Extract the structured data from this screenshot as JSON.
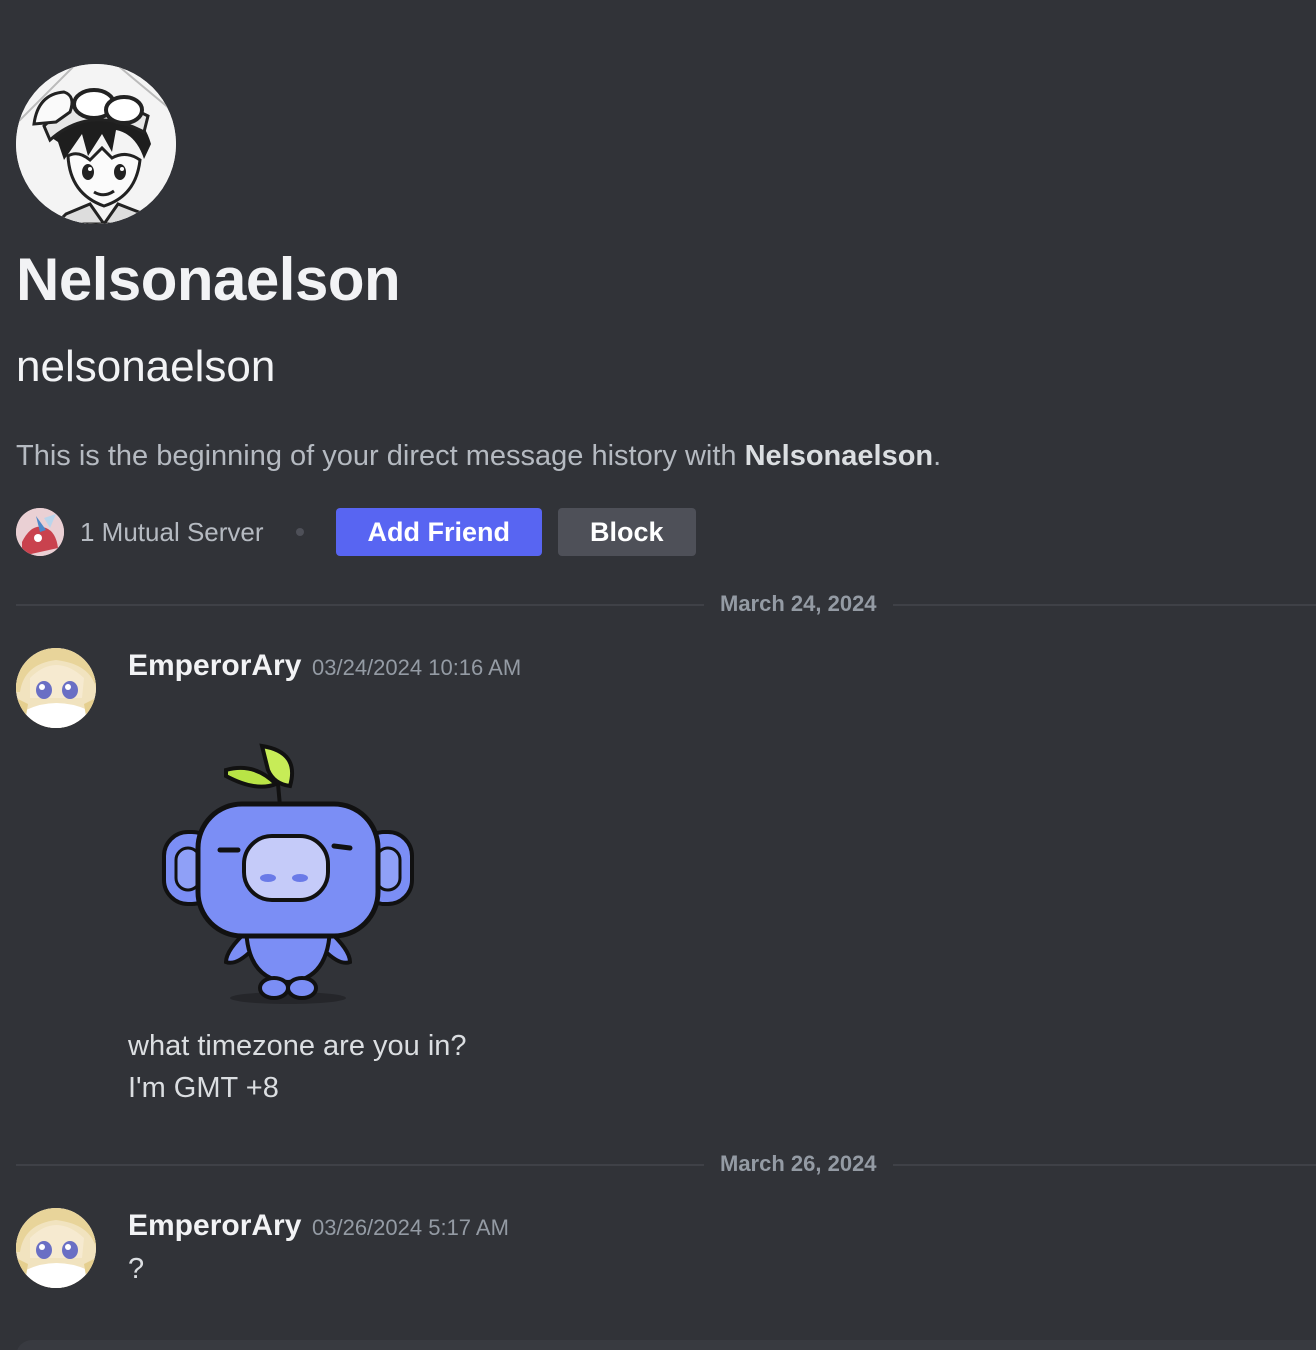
{
  "profile": {
    "display_name": "Nelsonaelson",
    "username": "nelsonaelson",
    "intro_prefix": "This is the beginning of your direct message history with ",
    "intro_name": "Nelsonaelson",
    "intro_suffix": "."
  },
  "actions": {
    "mutual_servers": "1 Mutual Server",
    "add_friend_label": "Add Friend",
    "block_label": "Block"
  },
  "days": [
    {
      "date_label": "March 24, 2024",
      "message": {
        "author": "EmperorAry",
        "timestamp": "03/24/2024 10:16 AM",
        "sticker": "wumpus-sticker",
        "lines": [
          "what timezone are you in?",
          "I'm GMT +8"
        ]
      }
    },
    {
      "date_label": "March 26, 2024",
      "message": {
        "author": "EmperorAry",
        "timestamp": "03/26/2024 5:17 AM",
        "lines": [
          "?"
        ]
      }
    }
  ],
  "colors": {
    "background": "#313338",
    "primary_button": "#5865f2",
    "secondary_button": "#4e5058",
    "muted_text": "#949ba4",
    "wumpus_blue": "#7b8ef5",
    "leaf_green": "#b9e446"
  },
  "icons": {
    "profile_avatar": "manga-boy-avatar",
    "mutual_server": "server-icon",
    "message_avatar": "anime-girl-avatar"
  }
}
